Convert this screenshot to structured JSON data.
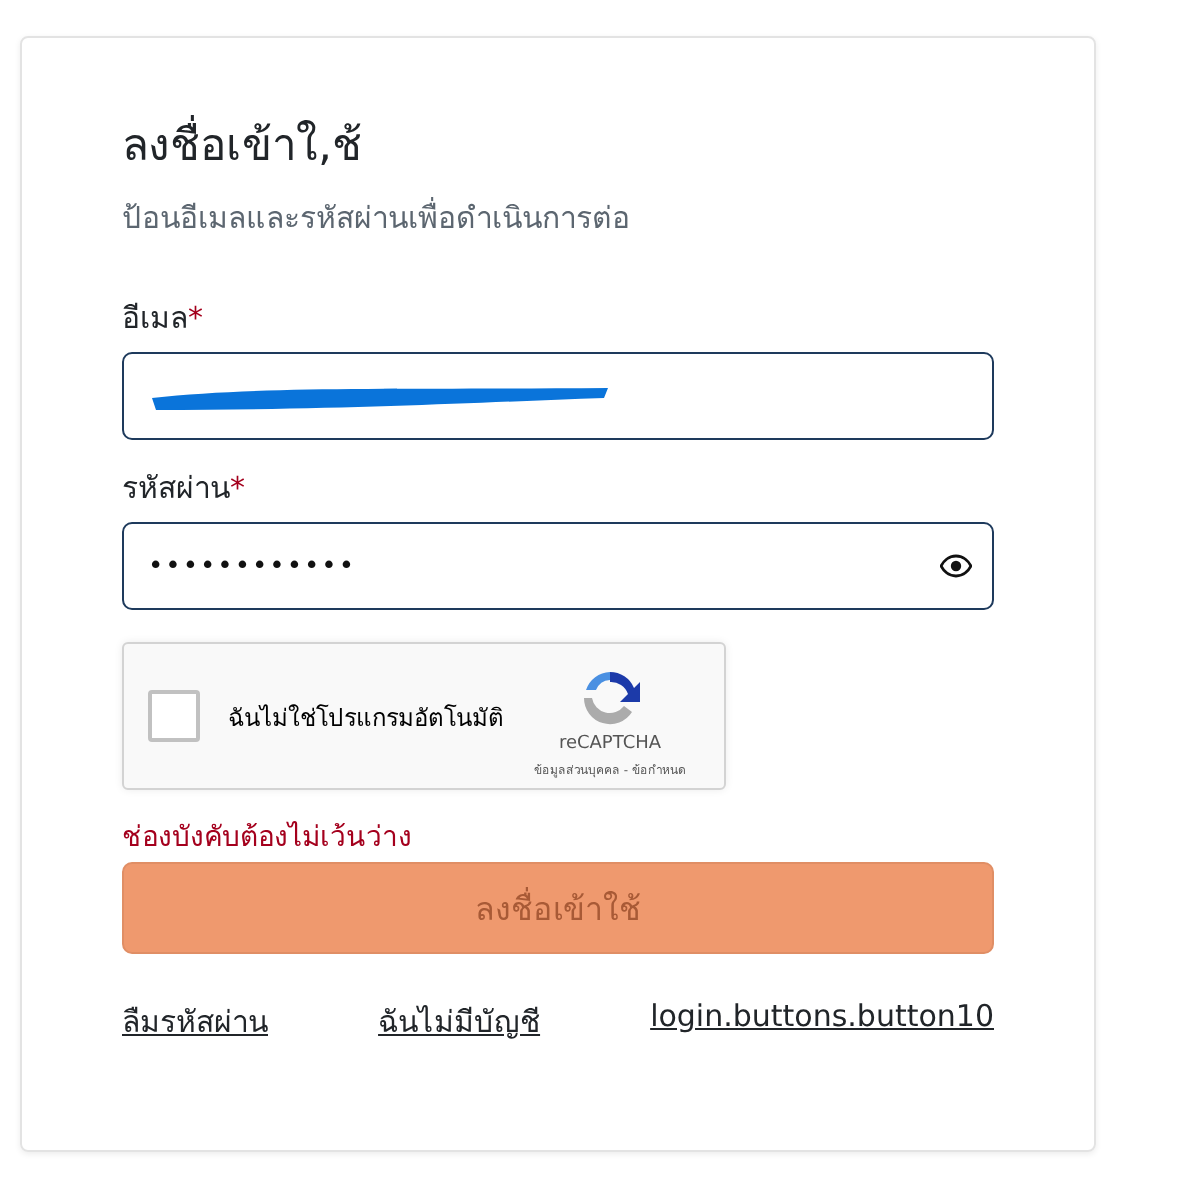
{
  "title": "ลงชื่อเข้าใ,ช้",
  "subtitle": "ป้อนอีเมลและรหัสผ่านเพื่อดำเนินการต่อ",
  "fields": [
    {
      "kind": "email",
      "label": "อีเมล",
      "marker": "*",
      "redacted": true
    },
    {
      "kind": "password",
      "label": "รหัสผ่าน",
      "marker": "*",
      "value": "••••••••••••"
    }
  ],
  "captcha": {
    "checked": false,
    "label": "ฉันไม่ใช่โปรแกรมอัตโนมัติ",
    "brand": "reCAPTCHA",
    "links": "ข้อมูลส่วนบุคคล - ข้อกำหนด"
  },
  "error": "ช่องบังคับต้องไม่เว้นว่าง",
  "submit": {
    "label": "ลงชื่อเข้าใช้",
    "disabled": true
  },
  "links": [
    "ลืมรหัสผ่าน",
    "ฉันไม่มีบัญชี",
    "login.buttons.button10"
  ]
}
